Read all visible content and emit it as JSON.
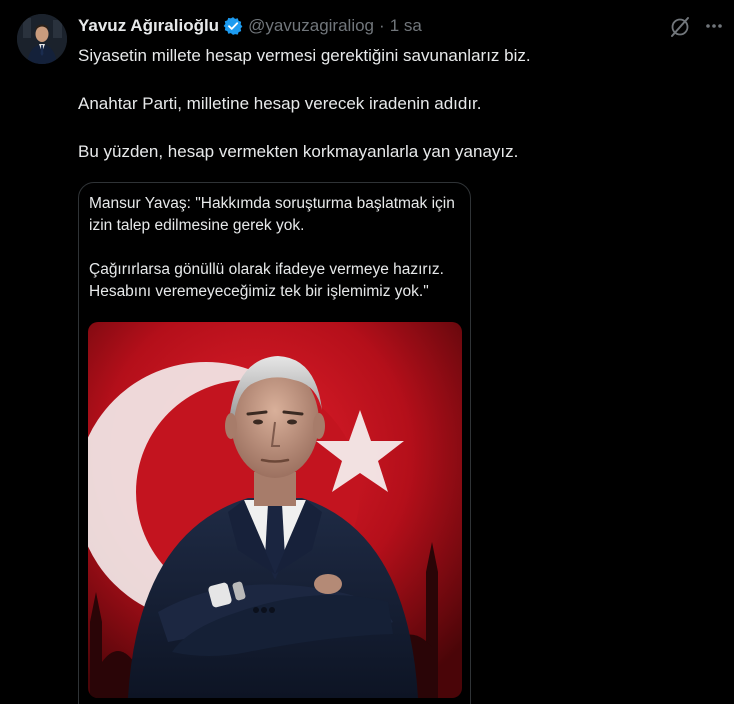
{
  "author": {
    "name": "Yavuz Ağıralioğlu",
    "handle": "@yavuzagiraliog",
    "separator": "·",
    "time": "1 sa"
  },
  "icons": {
    "verified": "verified-badge-icon",
    "grok": "grok-icon",
    "more": "more-options-icon"
  },
  "colors": {
    "background": "#000000",
    "text": "#e7e9ea",
    "secondary_text": "#71767b",
    "verified_blue": "#1d9bf0",
    "border": "#2f3336",
    "flag_red": "#c8101e"
  },
  "tweet": {
    "lines": [
      "Siyasetin millete hesap vermesi gerektiğini savunanlarız biz.",
      "Anahtar Parti, milletine hesap verecek iradenin adıdır.",
      "Bu yüzden, hesap vermekten korkmayanlarla yan yanayız."
    ]
  },
  "quote": {
    "paragraph1": "Mansur Yavaş: \"Hakkımda soruşturma başlatmak için izin talep edilmesine gerek yok.",
    "paragraph2": "Çağırırlarsa gönüllü olarak ifadeye vermeye hazırız. Hesabını veremeyeceğimiz tek bir işlemimiz yok.\""
  }
}
